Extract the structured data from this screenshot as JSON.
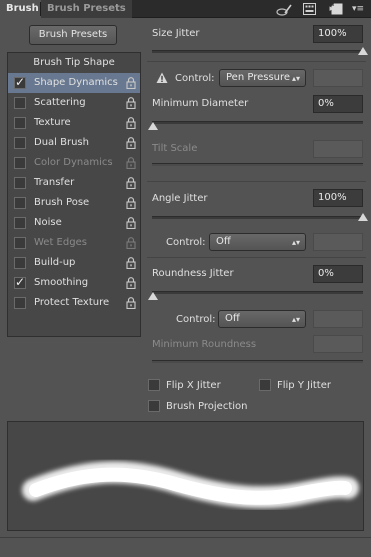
{
  "tabs": [
    {
      "label": "Brush",
      "active": true
    },
    {
      "label": "Brush Presets",
      "active": false
    }
  ],
  "tab_bar_icons": [
    "double-chevron-right-icon",
    "panel-menu-icon"
  ],
  "brush_presets_button": "Brush Presets",
  "list": {
    "header": "Brush Tip Shape",
    "items": [
      {
        "label": "Shape Dynamics",
        "checked": true,
        "selected": true,
        "disabled": false
      },
      {
        "label": "Scattering",
        "checked": false,
        "selected": false,
        "disabled": false
      },
      {
        "label": "Texture",
        "checked": false,
        "selected": false,
        "disabled": false
      },
      {
        "label": "Dual Brush",
        "checked": false,
        "selected": false,
        "disabled": false
      },
      {
        "label": "Color Dynamics",
        "checked": false,
        "selected": false,
        "disabled": true
      },
      {
        "label": "Transfer",
        "checked": false,
        "selected": false,
        "disabled": false
      },
      {
        "label": "Brush Pose",
        "checked": false,
        "selected": false,
        "disabled": false
      },
      {
        "label": "Noise",
        "checked": false,
        "selected": false,
        "disabled": false
      },
      {
        "label": "Wet Edges",
        "checked": false,
        "selected": false,
        "disabled": true
      },
      {
        "label": "Build-up",
        "checked": false,
        "selected": false,
        "disabled": false
      },
      {
        "label": "Smoothing",
        "checked": true,
        "selected": false,
        "disabled": false
      },
      {
        "label": "Protect Texture",
        "checked": false,
        "selected": false,
        "disabled": false
      }
    ]
  },
  "size_jitter": {
    "label": "Size Jitter",
    "value": "100%",
    "level": 1.0
  },
  "size_control": {
    "warning_icon": "warning-icon",
    "label": "Control:",
    "selected": "Pen Pressure"
  },
  "minimum_diameter": {
    "label": "Minimum Diameter",
    "value": "0%",
    "level": 0.0
  },
  "tilt_scale": {
    "label": "Tilt Scale"
  },
  "angle_jitter": {
    "label": "Angle Jitter",
    "value": "100%",
    "level": 1.0
  },
  "angle_control": {
    "label": "Control:",
    "selected": "Off"
  },
  "roundness_jitter": {
    "label": "Roundness Jitter",
    "value": "0%",
    "level": 0.0
  },
  "roundness_control": {
    "label": "Control:",
    "selected": "Off"
  },
  "minimum_roundness": {
    "label": "Minimum Roundness"
  },
  "flip_x": {
    "label": "Flip X Jitter",
    "checked": false
  },
  "flip_y": {
    "label": "Flip Y Jitter",
    "checked": false
  },
  "brush_projection": {
    "label": "Brush Projection",
    "checked": false
  },
  "bottom_icons": [
    "toggle-live-tip-preview-icon",
    "brush-grid-icon",
    "create-new-brush-icon"
  ],
  "colors": {
    "panel": "#535353",
    "selection": "#687890",
    "tab_bar": "#2b2b2b"
  }
}
